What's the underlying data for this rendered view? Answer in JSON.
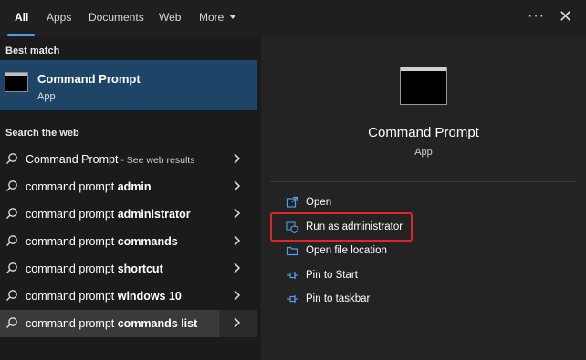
{
  "tabs": [
    {
      "label": "All",
      "active": true
    },
    {
      "label": "Apps",
      "active": false
    },
    {
      "label": "Documents",
      "active": false
    },
    {
      "label": "Web",
      "active": false
    },
    {
      "label": "More",
      "active": false
    }
  ],
  "header_icons": {
    "more_options": "ellipsis-icon",
    "close": "close-icon"
  },
  "best_match": {
    "heading": "Best match",
    "title": "Command Prompt",
    "subtitle": "App",
    "icon": "command-prompt-icon"
  },
  "search_web": {
    "heading": "Search the web",
    "items": [
      {
        "prefix": "Command Prompt",
        "bold": "",
        "suffix": " - See web results"
      },
      {
        "prefix": "command prompt ",
        "bold": "admin",
        "suffix": ""
      },
      {
        "prefix": "command prompt ",
        "bold": "administrator",
        "suffix": ""
      },
      {
        "prefix": "command prompt ",
        "bold": "commands",
        "suffix": ""
      },
      {
        "prefix": "command prompt ",
        "bold": "shortcut",
        "suffix": ""
      },
      {
        "prefix": "command prompt ",
        "bold": "windows 10",
        "suffix": ""
      },
      {
        "prefix": "command prompt ",
        "bold": "commands list",
        "suffix": ""
      }
    ]
  },
  "preview": {
    "title": "Command Prompt",
    "subtitle": "App",
    "actions": [
      {
        "label": "Open",
        "icon": "open-icon"
      },
      {
        "label": "Run as administrator",
        "icon": "shield-icon"
      },
      {
        "label": "Open file location",
        "icon": "folder-icon"
      },
      {
        "label": "Pin to Start",
        "icon": "pin-icon"
      },
      {
        "label": "Pin to taskbar",
        "icon": "pin-icon"
      }
    ]
  },
  "colors": {
    "accent": "#4c9ee8",
    "selection": "#1e4468",
    "highlight_box": "#e0252a"
  }
}
